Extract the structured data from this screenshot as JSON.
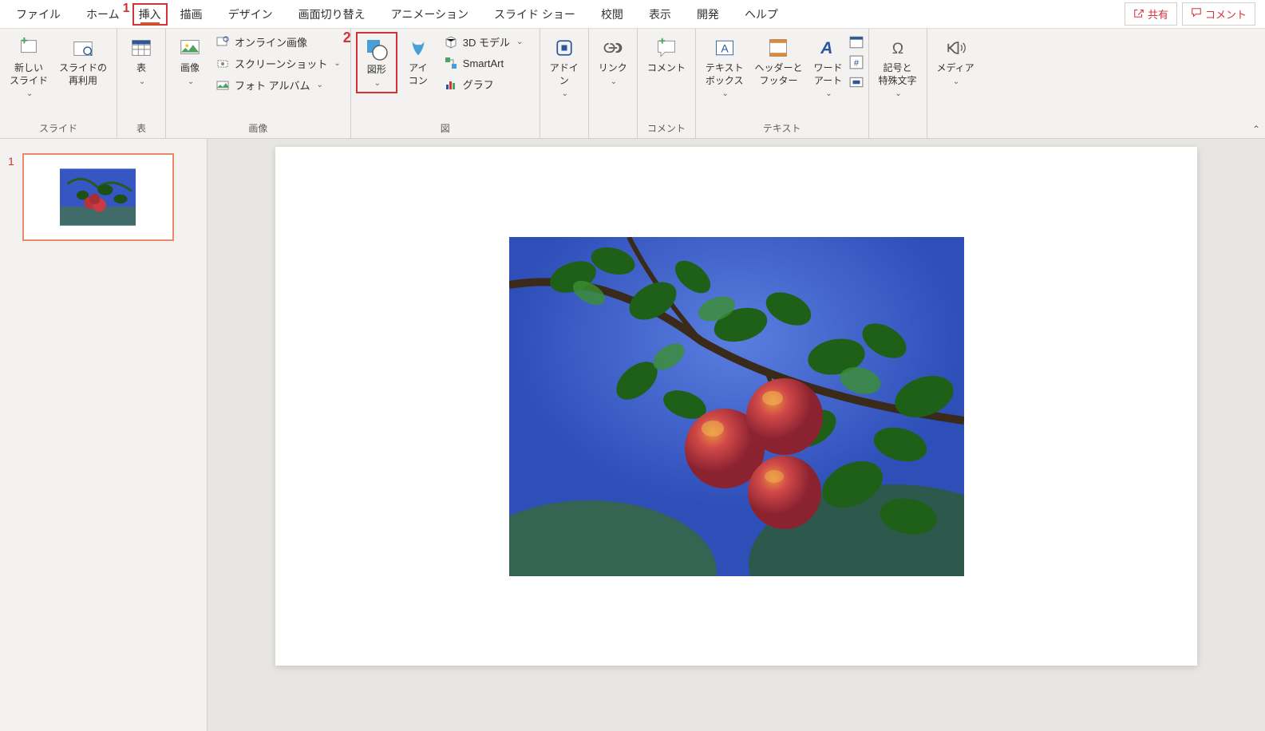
{
  "menubar": {
    "items": [
      "ファイル",
      "ホーム",
      "挿入",
      "描画",
      "デザイン",
      "画面切り替え",
      "アニメーション",
      "スライド ショー",
      "校閲",
      "表示",
      "開発",
      "ヘルプ"
    ],
    "active_index": 2,
    "share_label": "共有",
    "comment_label": "コメント"
  },
  "highlights": {
    "badge1": "1",
    "badge2": "2"
  },
  "ribbon": {
    "groups": {
      "slide": {
        "label": "スライド",
        "new_slide": "新しい\nスライド",
        "reuse_slide": "スライドの\n再利用"
      },
      "table": {
        "label": "表",
        "table": "表"
      },
      "image": {
        "label": "画像",
        "picture": "画像",
        "online_pic": "オンライン画像",
        "screenshot": "スクリーンショット",
        "photo_album": "フォト アルバム"
      },
      "illustration": {
        "label": "図",
        "shapes": "図形",
        "icons": "アイ\nコン",
        "models_3d": "3D モデル",
        "smartart": "SmartArt",
        "chart": "グラフ"
      },
      "addin": {
        "label": "",
        "addin": "アドイ\nン"
      },
      "link": {
        "label": "",
        "link": "リンク"
      },
      "comment": {
        "label": "コメント",
        "comment": "コメント"
      },
      "text": {
        "label": "テキスト",
        "textbox": "テキスト\nボックス",
        "header_footer": "ヘッダーと\nフッター",
        "wordart": "ワード\nアート"
      },
      "symbol": {
        "label": "",
        "symbol": "記号と\n特殊文字"
      },
      "media": {
        "label": "",
        "media": "メディア"
      }
    }
  },
  "slidepanel": {
    "thumbs": [
      {
        "num": "1"
      }
    ]
  }
}
